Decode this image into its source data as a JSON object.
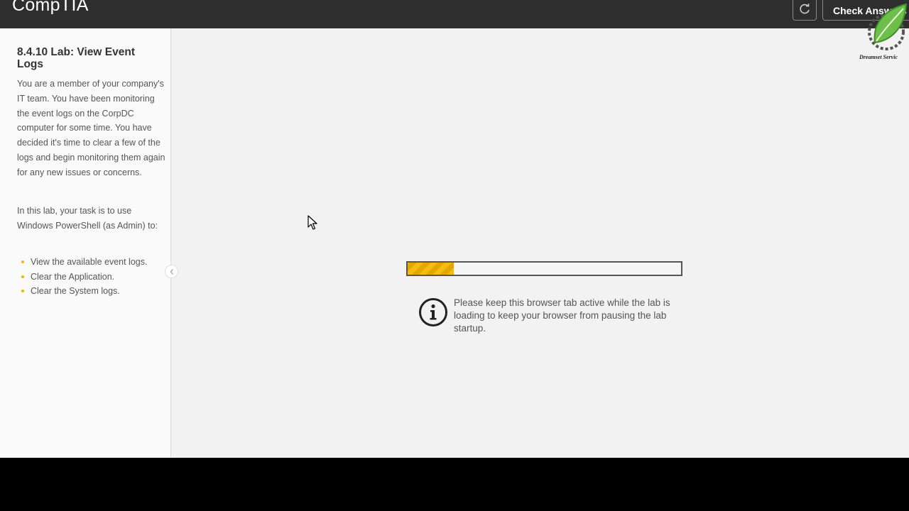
{
  "header": {
    "logo": "CompTIA",
    "check_answers_label": "Check Answers",
    "refresh_icon": "refresh-icon"
  },
  "sidebar": {
    "title": "8.4.10 Lab: View Event Logs",
    "paragraph_1": "You are a member of your company's IT team. You have been monitoring the event logs on the CorpDC computer for some time. You have decided it's time to clear a few of the logs and begin monitoring them again for any new issues or concerns.",
    "paragraph_2": "In this lab, your task is to use Windows PowerShell (as Admin) to:",
    "tasks": [
      "View the available event logs.",
      "Clear the Application.",
      "Clear the System logs."
    ],
    "collapse_icon": "chevron-left-icon"
  },
  "main": {
    "progress": 0.17,
    "info_icon": "info-icon",
    "info_text": "Please keep this browser tab active while the lab is loading to keep your browser from pausing the lab startup."
  },
  "watermark": {
    "text": "Dreamset Servic"
  },
  "colors": {
    "header_bg": "#2e2e2e",
    "progress_fill": "#f2bf10",
    "bullet": "#f2b705",
    "page_bg": "#f2f2f2"
  }
}
